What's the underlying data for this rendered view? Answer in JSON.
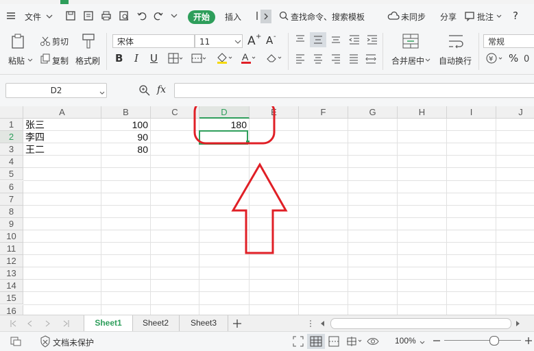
{
  "menu": {
    "file": "文件",
    "start": "开始",
    "insert": "插入",
    "search": "查找命令、搜索模板",
    "unsynced": "未同步",
    "share": "分享",
    "comment": "批注",
    "help": "?"
  },
  "toolbar": {
    "cut": "剪切",
    "copy": "复制",
    "paste": "粘贴",
    "format_painter": "格式刷",
    "font_name": "宋体",
    "font_size": "11",
    "bold": "B",
    "italic": "I",
    "underline": "U",
    "merge_center": "合并居中",
    "wrap_text": "自动换行",
    "number_format": "常规",
    "percent": "%",
    "grow": "A",
    "shrink": "A"
  },
  "formula_bar": {
    "name_box": "D2",
    "fx": "fx",
    "value": ""
  },
  "columns": [
    "A",
    "B",
    "C",
    "D",
    "E",
    "F",
    "G",
    "H",
    "I",
    "J"
  ],
  "rows": [
    "1",
    "2",
    "3",
    "4",
    "5",
    "6",
    "7",
    "8",
    "9",
    "10",
    "11",
    "12",
    "13",
    "14",
    "15",
    "16"
  ],
  "cells": {
    "A1": "张三",
    "A2": "李四",
    "A3": "王二",
    "B1": "100",
    "B2": "90",
    "B3": "80",
    "D1": "180"
  },
  "selected_cell": "D2",
  "sheets": [
    "Sheet1",
    "Sheet2",
    "Sheet3"
  ],
  "active_sheet": "Sheet1",
  "status": {
    "protect": "文档未保护",
    "zoom": "100%"
  },
  "colors": {
    "accent": "#2e9e5b",
    "highlight": "#e01f26"
  }
}
